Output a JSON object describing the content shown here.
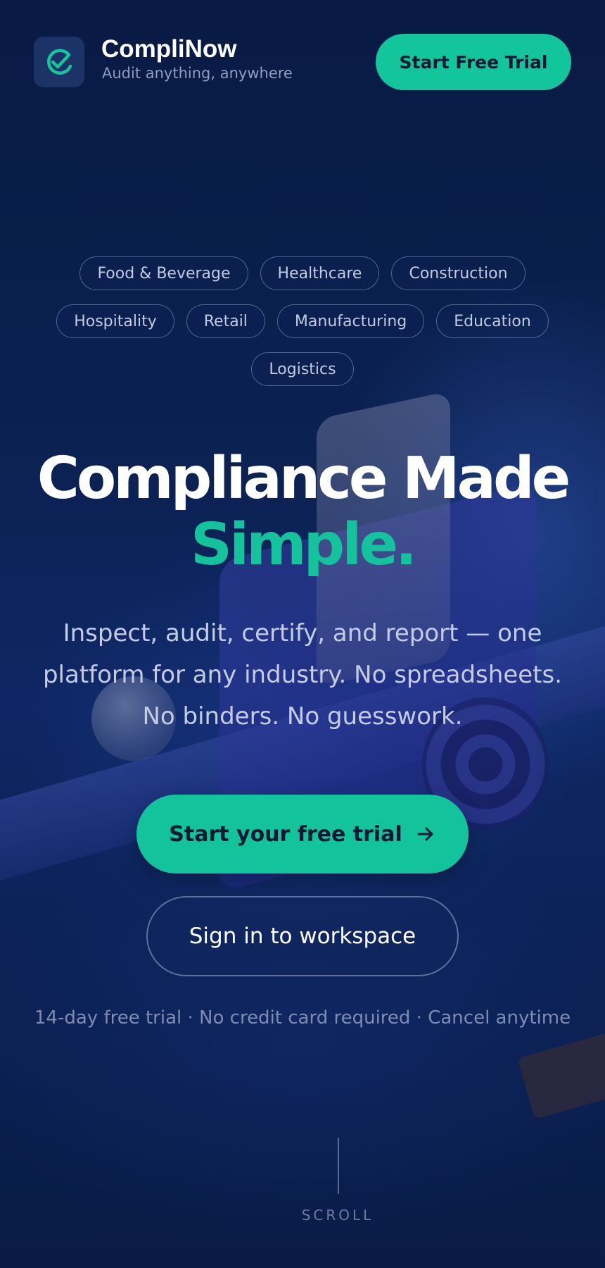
{
  "brand": {
    "name": "CompliNow",
    "tagline": "Audit anything, anywhere",
    "logo_icon": "checkmark-icon",
    "accent_color": "#13c59b"
  },
  "header": {
    "cta_label": "Start Free Trial"
  },
  "industries": [
    "Food & Beverage",
    "Healthcare",
    "Construction",
    "Hospitality",
    "Retail",
    "Manufacturing",
    "Education",
    "Logistics"
  ],
  "hero": {
    "headline": "Compliance Made",
    "headline_accent": "Simple.",
    "subcopy": "Inspect, audit, certify, and report — one platform for any industry. No spreadsheets. No binders. No guesswork.",
    "primary_cta": "Start your free trial",
    "primary_cta_icon": "arrow-right-icon",
    "secondary_cta": "Sign in to workspace",
    "fine_print": "14-day free trial · No credit card required · Cancel anytime"
  },
  "scroll_hint": "SCROLL"
}
